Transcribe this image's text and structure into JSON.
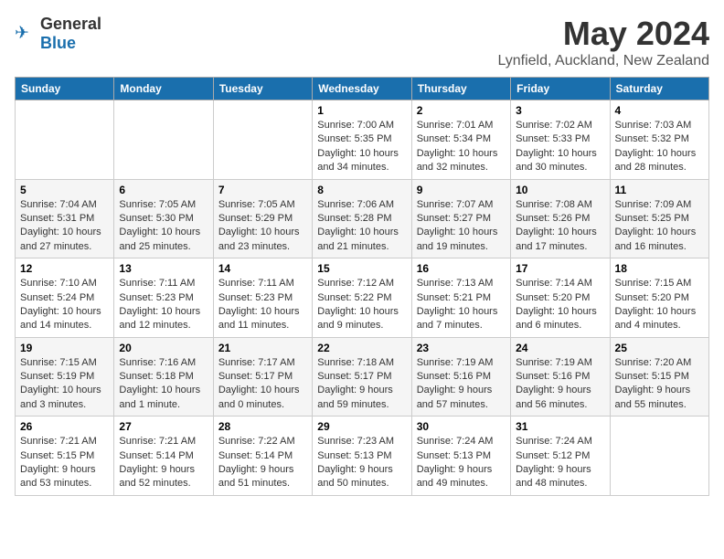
{
  "logo": {
    "general": "General",
    "blue": "Blue"
  },
  "title": "May 2024",
  "location": "Lynfield, Auckland, New Zealand",
  "days_header": [
    "Sunday",
    "Monday",
    "Tuesday",
    "Wednesday",
    "Thursday",
    "Friday",
    "Saturday"
  ],
  "weeks": [
    [
      {
        "day": "",
        "info": ""
      },
      {
        "day": "",
        "info": ""
      },
      {
        "day": "",
        "info": ""
      },
      {
        "day": "1",
        "info": "Sunrise: 7:00 AM\nSunset: 5:35 PM\nDaylight: 10 hours\nand 34 minutes."
      },
      {
        "day": "2",
        "info": "Sunrise: 7:01 AM\nSunset: 5:34 PM\nDaylight: 10 hours\nand 32 minutes."
      },
      {
        "day": "3",
        "info": "Sunrise: 7:02 AM\nSunset: 5:33 PM\nDaylight: 10 hours\nand 30 minutes."
      },
      {
        "day": "4",
        "info": "Sunrise: 7:03 AM\nSunset: 5:32 PM\nDaylight: 10 hours\nand 28 minutes."
      }
    ],
    [
      {
        "day": "5",
        "info": "Sunrise: 7:04 AM\nSunset: 5:31 PM\nDaylight: 10 hours\nand 27 minutes."
      },
      {
        "day": "6",
        "info": "Sunrise: 7:05 AM\nSunset: 5:30 PM\nDaylight: 10 hours\nand 25 minutes."
      },
      {
        "day": "7",
        "info": "Sunrise: 7:05 AM\nSunset: 5:29 PM\nDaylight: 10 hours\nand 23 minutes."
      },
      {
        "day": "8",
        "info": "Sunrise: 7:06 AM\nSunset: 5:28 PM\nDaylight: 10 hours\nand 21 minutes."
      },
      {
        "day": "9",
        "info": "Sunrise: 7:07 AM\nSunset: 5:27 PM\nDaylight: 10 hours\nand 19 minutes."
      },
      {
        "day": "10",
        "info": "Sunrise: 7:08 AM\nSunset: 5:26 PM\nDaylight: 10 hours\nand 17 minutes."
      },
      {
        "day": "11",
        "info": "Sunrise: 7:09 AM\nSunset: 5:25 PM\nDaylight: 10 hours\nand 16 minutes."
      }
    ],
    [
      {
        "day": "12",
        "info": "Sunrise: 7:10 AM\nSunset: 5:24 PM\nDaylight: 10 hours\nand 14 minutes."
      },
      {
        "day": "13",
        "info": "Sunrise: 7:11 AM\nSunset: 5:23 PM\nDaylight: 10 hours\nand 12 minutes."
      },
      {
        "day": "14",
        "info": "Sunrise: 7:11 AM\nSunset: 5:23 PM\nDaylight: 10 hours\nand 11 minutes."
      },
      {
        "day": "15",
        "info": "Sunrise: 7:12 AM\nSunset: 5:22 PM\nDaylight: 10 hours\nand 9 minutes."
      },
      {
        "day": "16",
        "info": "Sunrise: 7:13 AM\nSunset: 5:21 PM\nDaylight: 10 hours\nand 7 minutes."
      },
      {
        "day": "17",
        "info": "Sunrise: 7:14 AM\nSunset: 5:20 PM\nDaylight: 10 hours\nand 6 minutes."
      },
      {
        "day": "18",
        "info": "Sunrise: 7:15 AM\nSunset: 5:20 PM\nDaylight: 10 hours\nand 4 minutes."
      }
    ],
    [
      {
        "day": "19",
        "info": "Sunrise: 7:15 AM\nSunset: 5:19 PM\nDaylight: 10 hours\nand 3 minutes."
      },
      {
        "day": "20",
        "info": "Sunrise: 7:16 AM\nSunset: 5:18 PM\nDaylight: 10 hours\nand 1 minute."
      },
      {
        "day": "21",
        "info": "Sunrise: 7:17 AM\nSunset: 5:17 PM\nDaylight: 10 hours\nand 0 minutes."
      },
      {
        "day": "22",
        "info": "Sunrise: 7:18 AM\nSunset: 5:17 PM\nDaylight: 9 hours\nand 59 minutes."
      },
      {
        "day": "23",
        "info": "Sunrise: 7:19 AM\nSunset: 5:16 PM\nDaylight: 9 hours\nand 57 minutes."
      },
      {
        "day": "24",
        "info": "Sunrise: 7:19 AM\nSunset: 5:16 PM\nDaylight: 9 hours\nand 56 minutes."
      },
      {
        "day": "25",
        "info": "Sunrise: 7:20 AM\nSunset: 5:15 PM\nDaylight: 9 hours\nand 55 minutes."
      }
    ],
    [
      {
        "day": "26",
        "info": "Sunrise: 7:21 AM\nSunset: 5:15 PM\nDaylight: 9 hours\nand 53 minutes."
      },
      {
        "day": "27",
        "info": "Sunrise: 7:21 AM\nSunset: 5:14 PM\nDaylight: 9 hours\nand 52 minutes."
      },
      {
        "day": "28",
        "info": "Sunrise: 7:22 AM\nSunset: 5:14 PM\nDaylight: 9 hours\nand 51 minutes."
      },
      {
        "day": "29",
        "info": "Sunrise: 7:23 AM\nSunset: 5:13 PM\nDaylight: 9 hours\nand 50 minutes."
      },
      {
        "day": "30",
        "info": "Sunrise: 7:24 AM\nSunset: 5:13 PM\nDaylight: 9 hours\nand 49 minutes."
      },
      {
        "day": "31",
        "info": "Sunrise: 7:24 AM\nSunset: 5:12 PM\nDaylight: 9 hours\nand 48 minutes."
      },
      {
        "day": "",
        "info": ""
      }
    ]
  ]
}
